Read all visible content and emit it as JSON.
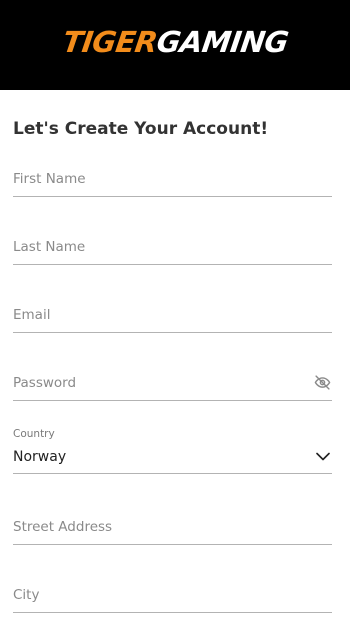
{
  "header": {
    "logo_tiger": "TIGER",
    "logo_gaming": "GAMING"
  },
  "page": {
    "title": "Let's Create Your Account!"
  },
  "form": {
    "first_name": {
      "placeholder": "First Name"
    },
    "last_name": {
      "placeholder": "Last Name"
    },
    "email": {
      "placeholder": "Email"
    },
    "password": {
      "placeholder": "Password",
      "icon": "eye-slash-icon"
    },
    "country": {
      "label": "Country",
      "value": "Norway",
      "icon": "chevron-down-icon"
    },
    "street_address": {
      "placeholder": "Street Address"
    },
    "city": {
      "placeholder": "City"
    }
  },
  "colors": {
    "header_bg": "#000000",
    "brand_orange": "#f28c1b",
    "field_border": "#b3b3b3",
    "placeholder": "#8a8a8a"
  }
}
